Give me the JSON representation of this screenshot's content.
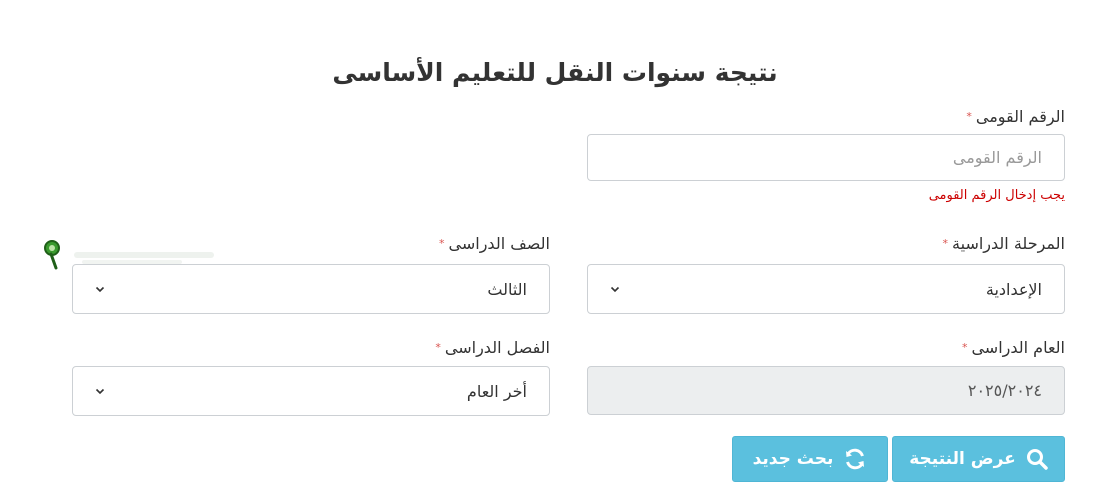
{
  "page": {
    "title": "نتيجة سنوات النقل للتعليم الأساسى"
  },
  "national_id": {
    "label": "الرقم القومى",
    "required_mark": "*",
    "placeholder": "الرقم القومى",
    "error": "يجب إدخال الرقم القومى"
  },
  "stage": {
    "label": "المرحلة الدراسية",
    "required_mark": "*",
    "value": "الإعدادية"
  },
  "grade": {
    "label": "الصف الدراسى",
    "required_mark": "*",
    "value": "الثالث"
  },
  "year": {
    "label": "العام الدراسى",
    "required_mark": "*",
    "value": "٢٠٢٥/٢٠٢٤"
  },
  "term": {
    "label": "الفصل الدراسى",
    "required_mark": "*",
    "value": "أخر العام"
  },
  "buttons": {
    "show_result": "عرض النتيجة",
    "new_search": "بحث جديد"
  },
  "colors": {
    "button": "#5bc0de",
    "error": "#cc0000",
    "required": "#d9534f"
  },
  "icons": {
    "show_result": "search-icon",
    "new_search": "refresh-icon",
    "select": "chevron-down-icon"
  }
}
